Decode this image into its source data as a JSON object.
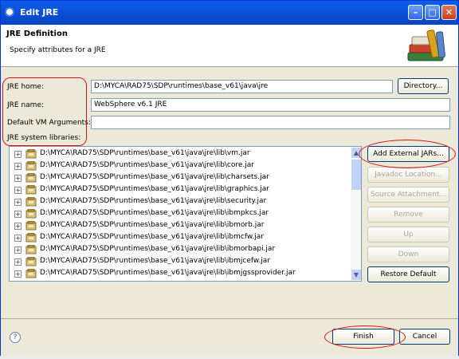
{
  "window": {
    "title": "Edit JRE"
  },
  "header": {
    "title": "JRE Definition",
    "subtitle": "Specify attributes for a JRE"
  },
  "form": {
    "jre_home_label": "JRE home:",
    "jre_home_value": "D:\\MYCA\\RAD75\\SDP\\runtimes\\base_v61\\java\\jre",
    "jre_name_label": "JRE name:",
    "jre_name_value": "WebSphere v6.1 JRE",
    "vm_args_label": "Default VM Arguments:",
    "vm_args_value": "",
    "libraries_label": "JRE system libraries:"
  },
  "buttons": {
    "directory": "Directory...",
    "add_external_jars": "Add External JARs...",
    "javadoc_location": "Javadoc Location...",
    "source_attachment": "Source Attachment...",
    "remove": "Remove",
    "up": "Up",
    "down": "Down",
    "restore_default": "Restore Default",
    "finish": "Finish",
    "cancel": "Cancel"
  },
  "libraries": [
    "D:\\MYCA\\RAD75\\SDP\\runtimes\\base_v61\\java\\jre\\lib\\vm.jar",
    "D:\\MYCA\\RAD75\\SDP\\runtimes\\base_v61\\java\\jre\\lib\\core.jar",
    "D:\\MYCA\\RAD75\\SDP\\runtimes\\base_v61\\java\\jre\\lib\\charsets.jar",
    "D:\\MYCA\\RAD75\\SDP\\runtimes\\base_v61\\java\\jre\\lib\\graphics.jar",
    "D:\\MYCA\\RAD75\\SDP\\runtimes\\base_v61\\java\\jre\\lib\\security.jar",
    "D:\\MYCA\\RAD75\\SDP\\runtimes\\base_v61\\java\\jre\\lib\\ibmpkcs.jar",
    "D:\\MYCA\\RAD75\\SDP\\runtimes\\base_v61\\java\\jre\\lib\\ibmorb.jar",
    "D:\\MYCA\\RAD75\\SDP\\runtimes\\base_v61\\java\\jre\\lib\\ibmcfw.jar",
    "D:\\MYCA\\RAD75\\SDP\\runtimes\\base_v61\\java\\jre\\lib\\ibmorbapi.jar",
    "D:\\MYCA\\RAD75\\SDP\\runtimes\\base_v61\\java\\jre\\lib\\ibmjcefw.jar",
    "D:\\MYCA\\RAD75\\SDP\\runtimes\\base_v61\\java\\jre\\lib\\ibmjgssprovider.jar"
  ],
  "icons": {
    "app": "eclipse-window-icon",
    "header": "books-icon",
    "library": "jar-icon",
    "help": "help-icon"
  },
  "colors": {
    "annotation": "#dd1111",
    "titlebar": "#0b4fd6",
    "dialog_bg": "#ece9d8"
  }
}
